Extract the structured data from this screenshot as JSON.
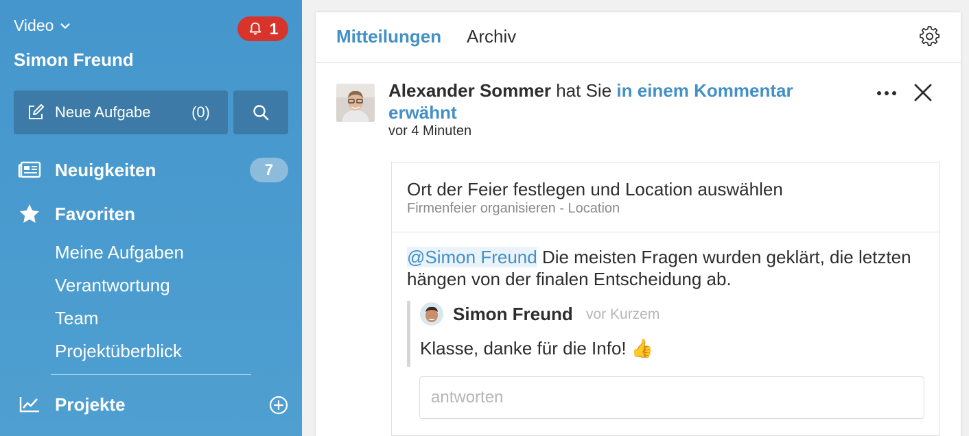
{
  "sidebar": {
    "workspace": "Video",
    "notification_count": "1",
    "user_name": "Simon Freund",
    "new_task_label": "Neue Aufgabe",
    "new_task_count": "(0)",
    "nav": {
      "news_label": "Neuigkeiten",
      "news_count": "7",
      "favorites_label": "Favoriten",
      "projects_label": "Projekte"
    },
    "favorites_items": [
      "Meine Aufgaben",
      "Verantwortung",
      "Team",
      "Projektüberblick"
    ]
  },
  "panel": {
    "tabs": [
      {
        "label": "Mitteilungen",
        "active": true
      },
      {
        "label": "Archiv",
        "active": false
      }
    ],
    "notification": {
      "actor": "Alexander Sommer",
      "text_middle": "hat Sie",
      "link_text": "in einem Kommentar erwähnt",
      "time": "vor 4 Minuten"
    },
    "task": {
      "title": "Ort der Feier festlegen und Location auswählen",
      "subtitle": "Firmenfeier organisieren - Location"
    },
    "comment": {
      "mention": "@Simon Freund",
      "text": "Die meisten Fragen wurden geklärt, die letzten hängen von der finalen Entscheidung ab."
    },
    "reply": {
      "author": "Simon Freund",
      "time": "vor Kurzem",
      "text": "Klasse, danke für die Info! 👍"
    },
    "reply_input": {
      "placeholder": "antworten",
      "value": ""
    }
  },
  "colors": {
    "sidebar": "#4a9ad0",
    "accent": "#4290c5",
    "alert": "#d9342b"
  }
}
